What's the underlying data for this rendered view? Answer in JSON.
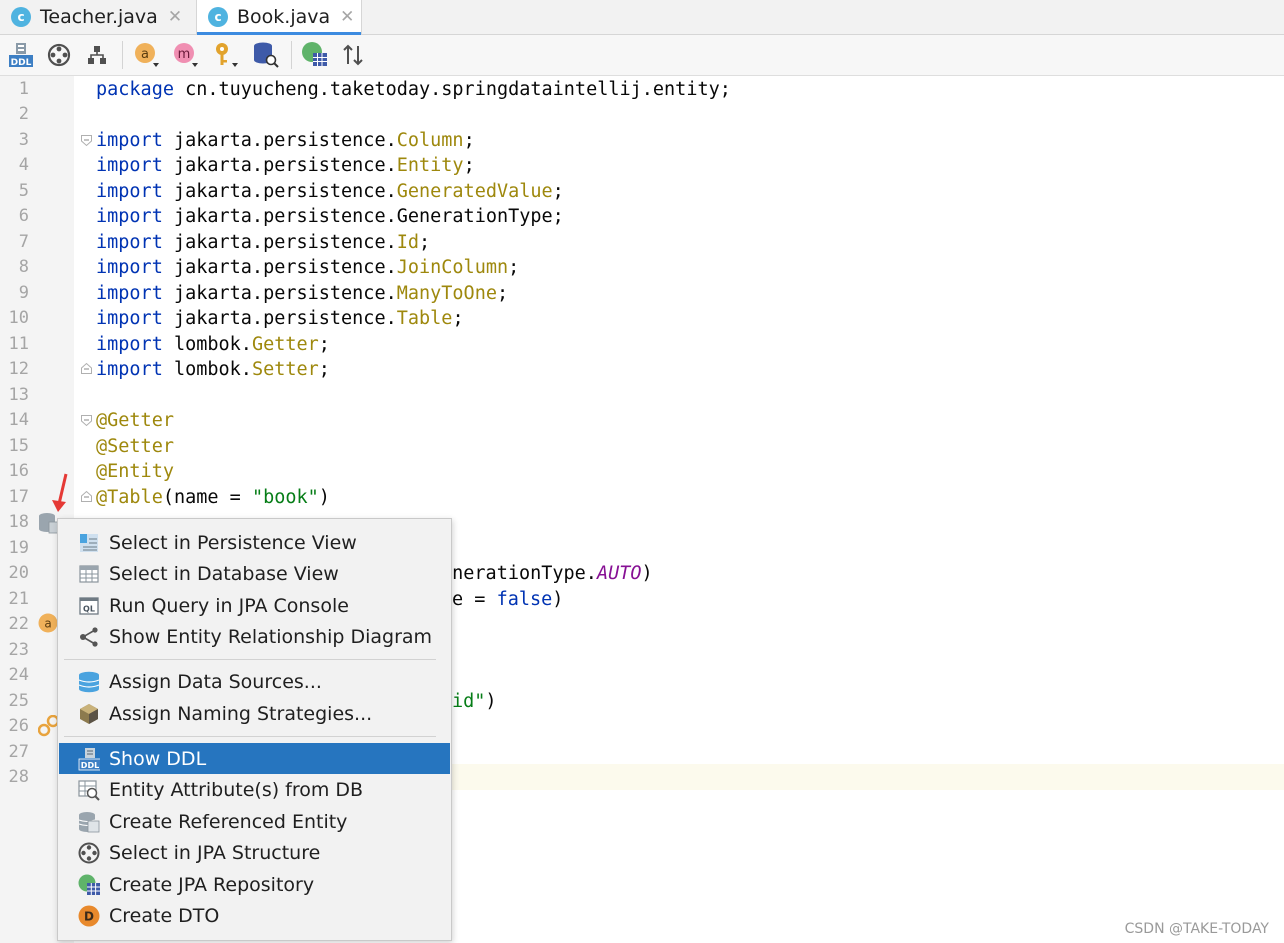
{
  "tabs": [
    {
      "label": "Teacher.java",
      "icon": "class-icon",
      "active": false
    },
    {
      "label": "Book.java",
      "icon": "class-icon",
      "active": true
    }
  ],
  "class_icon_letter": "c",
  "toolbar": {
    "ddl_label": "DDL",
    "a_letter": "a",
    "m_letter": "m"
  },
  "editor": {
    "lines": [
      "1",
      "2",
      "3",
      "4",
      "5",
      "6",
      "7",
      "8",
      "9",
      "10",
      "11",
      "12",
      "13",
      "14",
      "15",
      "16",
      "17",
      "18",
      "19",
      "20",
      "21",
      "22",
      "23",
      "24",
      "25",
      "26",
      "27",
      "28"
    ],
    "code": {
      "l1_kw": "package",
      "l1_rest": " cn.tuyucheng.taketoday.springdataintellij.entity;",
      "import_kw": "import",
      "pkg": " jakarta.persistence.",
      "l3_cls": "Column",
      "l4_cls": "Entity",
      "l5_cls": "GeneratedValue",
      "l6_plain": "GenerationType",
      "l7_cls": "Id",
      "l8_cls": "JoinColumn",
      "l9_cls": "ManyToOne",
      "l10_cls": "Table",
      "lombok": " lombok.",
      "l11_cls": "Getter",
      "l12_cls": "Setter",
      "semicolon": ";",
      "l14": "@Getter",
      "l15": "@Setter",
      "l16": "@Entity",
      "l17_ann": "@Table",
      "l17_open": "(name = ",
      "l17_str": "\"book\"",
      "l17_close": ")",
      "l20_text": "enerationType.",
      "l20_const": "AUTO",
      "l20_close": ")",
      "l21_text": "e = ",
      "l21_kw": "false",
      "l21_close": ")",
      "l25_str": "id\"",
      "l25_close": ")"
    }
  },
  "context_menu": {
    "items": [
      {
        "label": "Select in Persistence View",
        "icon": "persistence-view-icon"
      },
      {
        "label": "Select in Database View",
        "icon": "database-table-icon"
      },
      {
        "label": "Run Query in JPA Console",
        "icon": "jpa-console-icon"
      },
      {
        "label": "Show Entity Relationship Diagram",
        "icon": "diagram-icon"
      },
      {
        "label": "Assign Data Sources...",
        "icon": "datasource-icon"
      },
      {
        "label": "Assign Naming Strategies...",
        "icon": "naming-strategy-icon"
      },
      {
        "label": "Show DDL",
        "icon": "ddl-icon",
        "selected": true
      },
      {
        "label": "Entity Attribute(s) from DB",
        "icon": "entity-attributes-icon"
      },
      {
        "label": "Create Referenced Entity",
        "icon": "referenced-entity-icon"
      },
      {
        "label": "Select in JPA Structure",
        "icon": "jpa-structure-icon"
      },
      {
        "label": "Create JPA Repository",
        "icon": "jpa-repository-icon"
      },
      {
        "label": "Create DTO",
        "icon": "dto-icon"
      }
    ],
    "ql_text": "QL",
    "ddl_text": "DDL",
    "dto_letter": "D"
  },
  "colors": {
    "keyword": "#0033b3",
    "annotation": "#9e880d",
    "string": "#067d17",
    "constant": "#871094",
    "selection": "#2675bf",
    "arrow": "#e53935"
  },
  "watermark": "CSDN @TAKE-TODAY"
}
